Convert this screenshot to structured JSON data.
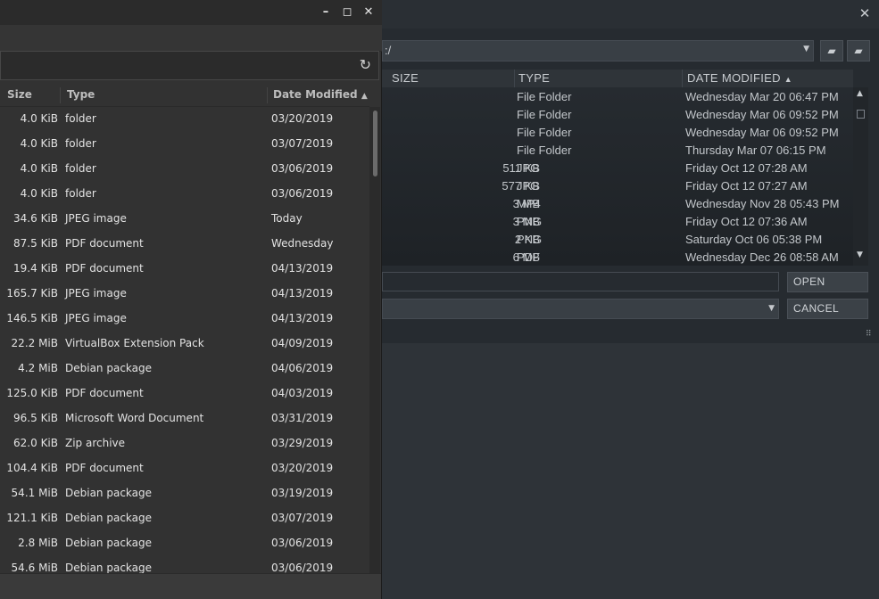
{
  "back_dialog": {
    "path": ":/",
    "columns": {
      "size": "SIZE",
      "type": "TYPE",
      "date_modified": "DATE MODIFIED"
    },
    "rows": [
      {
        "size": "",
        "type": "File Folder",
        "date": "Wednesday Mar 20 06:47 PM"
      },
      {
        "size": "",
        "type": "File Folder",
        "date": "Wednesday Mar 06 09:52 PM"
      },
      {
        "size": "",
        "type": "File Folder",
        "date": "Wednesday Mar 06 09:52 PM"
      },
      {
        "size": "",
        "type": "File Folder",
        "date": "Thursday Mar 07 06:15 PM"
      },
      {
        "size": "511 KB",
        "type": "JPG",
        "date": "Friday Oct 12 07:28 AM"
      },
      {
        "size": "577 KB",
        "type": "JPG",
        "date": "Friday Oct 12 07:27 AM"
      },
      {
        "size": "3 MB",
        "type": "MP4",
        "date": "Wednesday Nov 28 05:43 PM"
      },
      {
        "size": "3 MB",
        "type": "PNG",
        "date": "Friday Oct 12 07:36 AM"
      },
      {
        "size": "2 KB",
        "type": "PNG",
        "date": "Saturday Oct 06 05:38 PM"
      },
      {
        "size": "6 MB",
        "type": "PDF",
        "date": "Wednesday Dec 26 08:58 AM"
      }
    ],
    "open_label": "OPEN",
    "cancel_label": "CANCEL",
    "icons": {
      "close": "close-icon",
      "dropdown": "chevron-down-icon",
      "up_folder": "folder-up-icon",
      "new_folder": "new-folder-icon"
    }
  },
  "front_window": {
    "columns": {
      "size": "Size",
      "type": "Type",
      "date_modified": "Date Modified"
    },
    "rows": [
      {
        "size": "4.0 KiB",
        "type": "folder",
        "date": "03/20/2019"
      },
      {
        "size": "4.0 KiB",
        "type": "folder",
        "date": "03/07/2019"
      },
      {
        "size": "4.0 KiB",
        "type": "folder",
        "date": "03/06/2019"
      },
      {
        "size": "4.0 KiB",
        "type": "folder",
        "date": "03/06/2019"
      },
      {
        "size": "34.6 KiB",
        "type": "JPEG image",
        "date": "Today"
      },
      {
        "size": "87.5 KiB",
        "type": "PDF document",
        "date": "Wednesday"
      },
      {
        "size": "19.4 KiB",
        "type": "PDF document",
        "date": "04/13/2019"
      },
      {
        "size": "165.7 KiB",
        "type": "JPEG image",
        "date": "04/13/2019"
      },
      {
        "size": "146.5 KiB",
        "type": "JPEG image",
        "date": "04/13/2019"
      },
      {
        "size": "22.2 MiB",
        "type": "VirtualBox Extension Pack",
        "date": "04/09/2019"
      },
      {
        "size": "4.2 MiB",
        "type": "Debian package",
        "date": "04/06/2019"
      },
      {
        "size": "125.0 KiB",
        "type": "PDF document",
        "date": "04/03/2019"
      },
      {
        "size": "96.5 KiB",
        "type": "Microsoft Word Document",
        "date": "03/31/2019"
      },
      {
        "size": "62.0 KiB",
        "type": "Zip archive",
        "date": "03/29/2019"
      },
      {
        "size": "104.4 KiB",
        "type": "PDF document",
        "date": "03/20/2019"
      },
      {
        "size": "54.1 MiB",
        "type": "Debian package",
        "date": "03/19/2019"
      },
      {
        "size": "121.1 KiB",
        "type": "Debian package",
        "date": "03/07/2019"
      },
      {
        "size": "2.8 MiB",
        "type": "Debian package",
        "date": "03/06/2019"
      },
      {
        "size": "54.6 MiB",
        "type": "Debian package",
        "date": "03/06/2019"
      }
    ],
    "icons": {
      "minimize": "minimize-icon",
      "maximize": "maximize-icon",
      "close": "close-icon",
      "reload": "reload-icon",
      "sort": "sort-ascending-icon"
    }
  }
}
